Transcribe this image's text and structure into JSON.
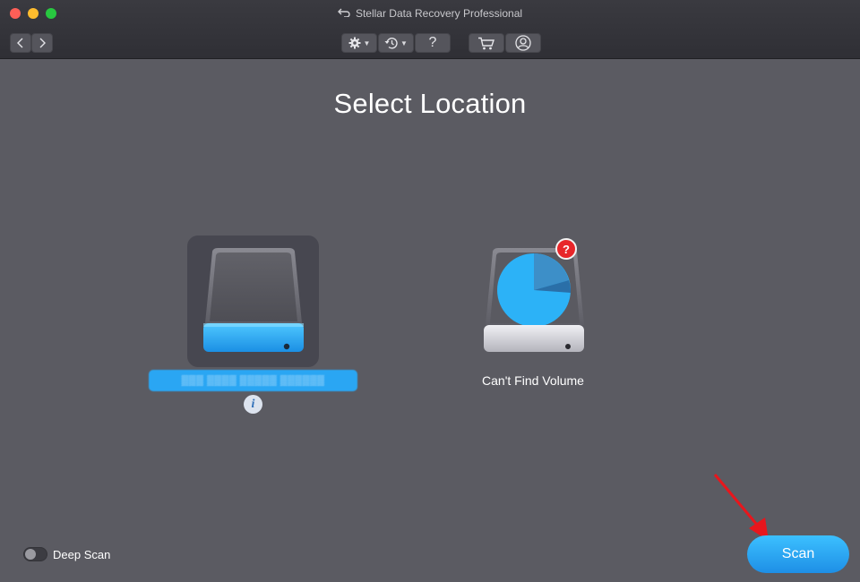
{
  "window": {
    "title": "Stellar Data Recovery Professional"
  },
  "toolbar": {
    "nav_back_icon": "chevron-left-icon",
    "nav_forward_icon": "chevron-right-icon",
    "settings_icon": "gear-icon",
    "history_icon": "history-icon",
    "help_label": "?",
    "cart_icon": "cart-icon",
    "account_icon": "user-icon"
  },
  "main": {
    "title": "Select Location",
    "drives": [
      {
        "label": "▒▒▒ ▒▒▒▒ ▒▒▒▒▒ ▒▒▒▒▒▒",
        "selected": true,
        "icon": "hard-drive-icon",
        "accent": "#2aa6f3"
      },
      {
        "label": "Can't Find Volume",
        "selected": false,
        "icon": "volume-search-icon",
        "badge": "?"
      }
    ],
    "info_label": "i"
  },
  "footer": {
    "deep_scan_label": "Deep Scan",
    "deep_scan_enabled": false,
    "scan_label": "Scan"
  },
  "colors": {
    "accent": "#2aa6f3",
    "background": "#5b5b62",
    "badge": "#e8262a"
  }
}
